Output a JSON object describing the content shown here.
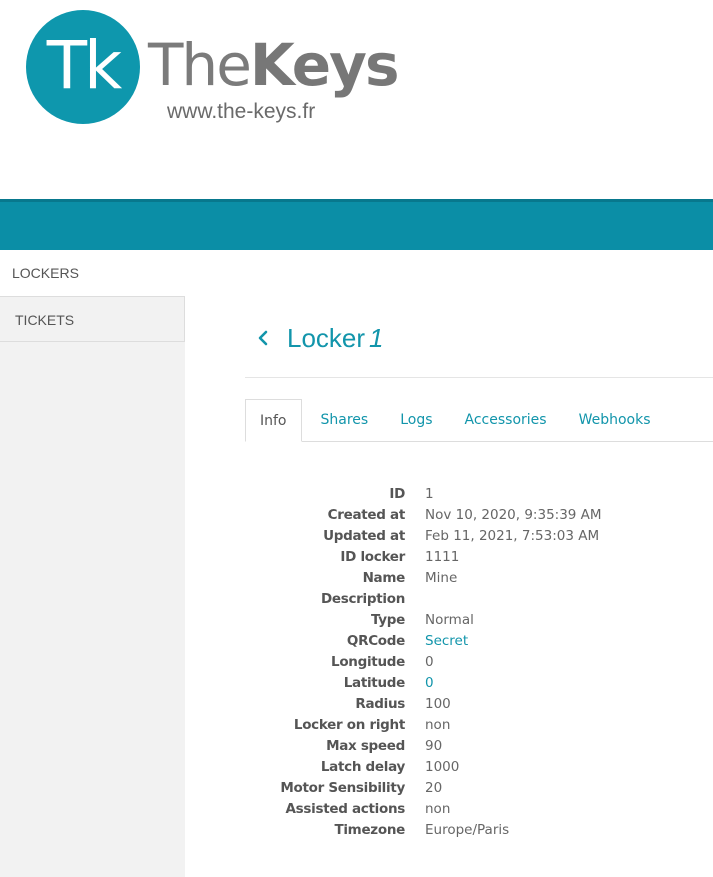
{
  "logo": {
    "circle_text": "Tk",
    "word_thin": "The",
    "word_bold": "Keys",
    "url": "www.the-keys.fr",
    "brand_color": "#0e97ad"
  },
  "sidebar": {
    "items": [
      {
        "label": "LOCKERS",
        "active": true
      },
      {
        "label": "TICKETS",
        "active": false
      }
    ]
  },
  "page": {
    "back_icon": "chevron-left-icon",
    "title_prefix": "Locker",
    "title_id": "1"
  },
  "tabs": [
    {
      "label": "Info",
      "active": true
    },
    {
      "label": "Shares",
      "active": false
    },
    {
      "label": "Logs",
      "active": false
    },
    {
      "label": "Accessories",
      "active": false
    },
    {
      "label": "Webhooks",
      "active": false
    }
  ],
  "info": [
    {
      "key": "ID",
      "value": "1"
    },
    {
      "key": "Created at",
      "value": "Nov 10, 2020, 9:35:39 AM"
    },
    {
      "key": "Updated at",
      "value": "Feb 11, 2021, 7:53:03 AM"
    },
    {
      "key": "ID locker",
      "value": "1111"
    },
    {
      "key": "Name",
      "value": "Mine"
    },
    {
      "key": "Description",
      "value": ""
    },
    {
      "key": "Type",
      "value": "Normal"
    },
    {
      "key": "QRCode",
      "value": "Secret",
      "link": true
    },
    {
      "key": "Longitude",
      "value": "0"
    },
    {
      "key": "Latitude",
      "value": "0",
      "link": true
    },
    {
      "key": "Radius",
      "value": "100"
    },
    {
      "key": "Locker on right",
      "value": "non"
    },
    {
      "key": "Max speed",
      "value": "90"
    },
    {
      "key": "Latch delay",
      "value": "1000"
    },
    {
      "key": "Motor Sensibility",
      "value": "20"
    },
    {
      "key": "Assisted actions",
      "value": "non"
    },
    {
      "key": "Timezone",
      "value": "Europe/Paris"
    }
  ],
  "colors": {
    "accent": "#1295ab",
    "header_bar": "#0b8ea6",
    "sidebar_bg": "#f2f2f2"
  }
}
